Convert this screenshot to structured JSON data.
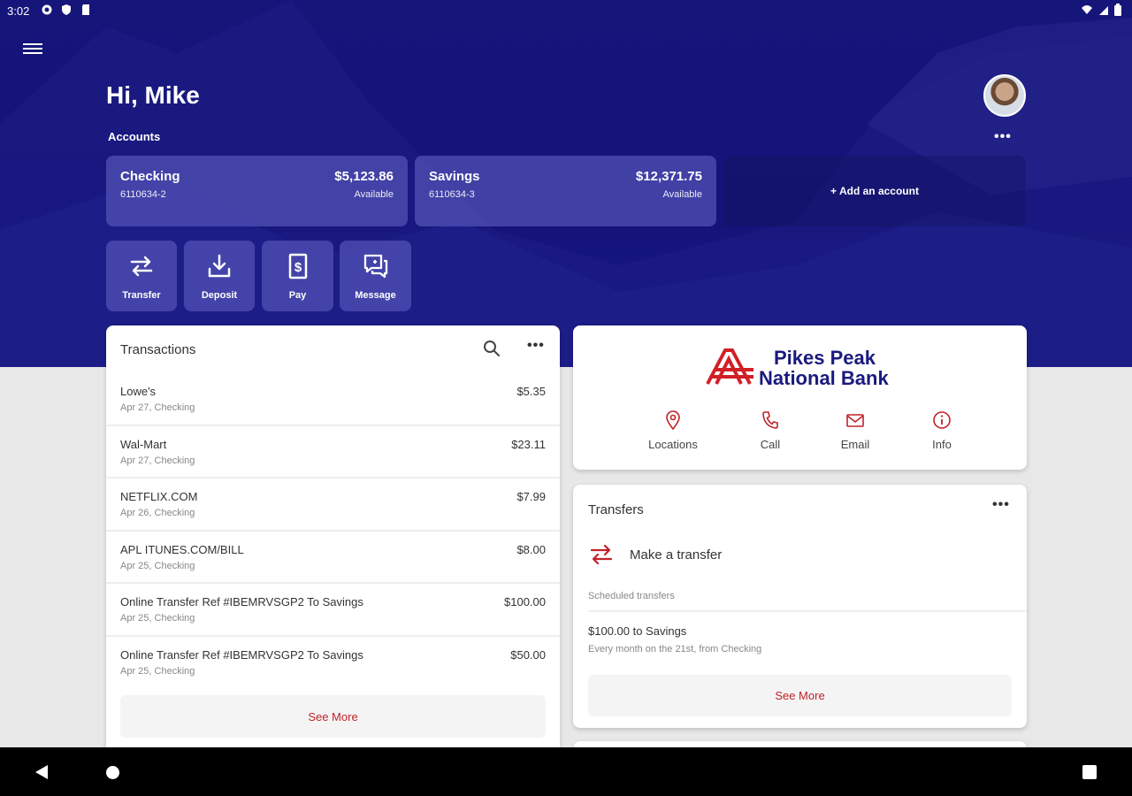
{
  "status_bar": {
    "time": "3:02"
  },
  "header": {
    "greeting": "Hi, Mike",
    "accounts_label": "Accounts",
    "more_label": "•••"
  },
  "accounts": [
    {
      "name": "Checking",
      "number": "6110634-2",
      "balance": "$5,123.86",
      "balance_label": "Available"
    },
    {
      "name": "Savings",
      "number": "6110634-3",
      "balance": "$12,371.75",
      "balance_label": "Available"
    }
  ],
  "add_account_label": "+ Add an account",
  "quick_actions": [
    {
      "label": "Transfer",
      "icon": "transfer-icon"
    },
    {
      "label": "Deposit",
      "icon": "deposit-icon"
    },
    {
      "label": "Pay",
      "icon": "pay-icon"
    },
    {
      "label": "Message",
      "icon": "message-icon"
    }
  ],
  "transactions": {
    "title": "Transactions",
    "more_label": "•••",
    "items": [
      {
        "merchant": "Lowe's",
        "detail": "Apr 27, Checking",
        "amount": "$5.35"
      },
      {
        "merchant": "Wal-Mart",
        "detail": "Apr 27, Checking",
        "amount": "$23.11"
      },
      {
        "merchant": "NETFLIX.COM",
        "detail": "Apr 26, Checking",
        "amount": "$7.99"
      },
      {
        "merchant": "APL ITUNES.COM/BILL",
        "detail": "Apr 25, Checking",
        "amount": "$8.00"
      },
      {
        "merchant": "Online Transfer Ref #IBEMRVSGP2 To Savings",
        "detail": "Apr 25, Checking",
        "amount": "$100.00"
      },
      {
        "merchant": "Online Transfer Ref #IBEMRVSGP2 To Savings",
        "detail": "Apr 25, Checking",
        "amount": "$50.00"
      }
    ],
    "see_more_label": "See More"
  },
  "bank": {
    "name_line1": "Pikes Peak",
    "name_line2": "National Bank",
    "actions": [
      {
        "label": "Locations",
        "icon": "location-pin-icon"
      },
      {
        "label": "Call",
        "icon": "phone-icon"
      },
      {
        "label": "Email",
        "icon": "email-icon"
      },
      {
        "label": "Info",
        "icon": "info-icon"
      }
    ]
  },
  "transfers": {
    "title": "Transfers",
    "more_label": "•••",
    "make_transfer_label": "Make a transfer",
    "scheduled_label": "Scheduled transfers",
    "scheduled_items": [
      {
        "title": "$100.00 to Savings",
        "subtitle": "Every month on the 21st, from Checking"
      }
    ],
    "see_more_label": "See More"
  },
  "colors": {
    "brand_navy": "#15157a",
    "accent_red": "#c0222a",
    "card_blue": "#5050b4"
  }
}
